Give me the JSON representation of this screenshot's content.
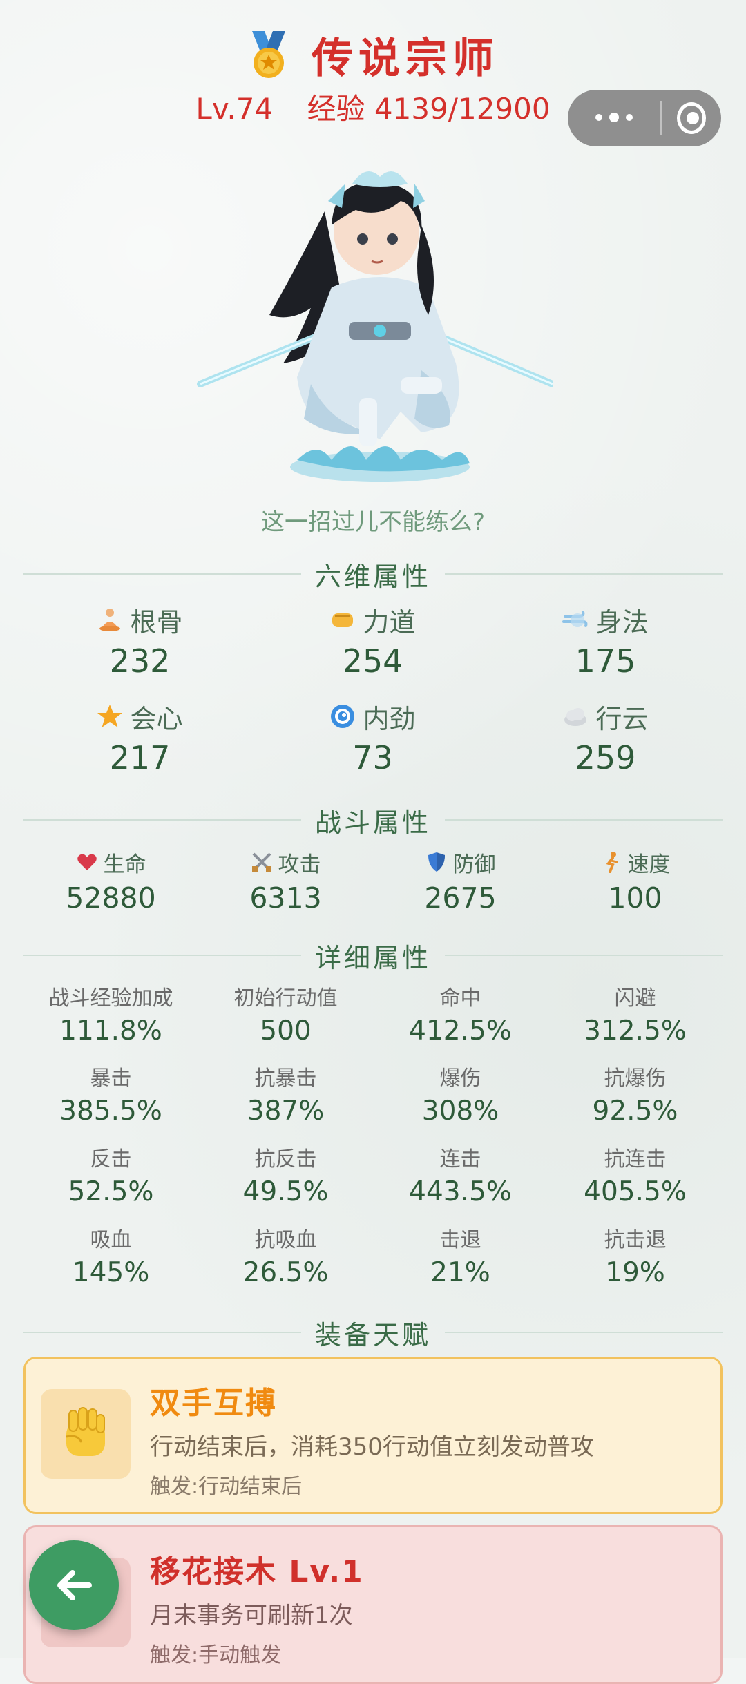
{
  "header": {
    "rank_title": "传说宗师",
    "level": "Lv.74",
    "exp_text": "经验 4139/12900"
  },
  "character": {
    "quote": "这一招过儿不能练么?"
  },
  "sections": {
    "six": "六维属性",
    "combat": "战斗属性",
    "detail": "详细属性",
    "talent": "装备天赋"
  },
  "six_attrs": [
    {
      "label": "根骨",
      "value": "232",
      "icon": "meditate-icon"
    },
    {
      "label": "力道",
      "value": "254",
      "icon": "fist-icon"
    },
    {
      "label": "身法",
      "value": "175",
      "icon": "wind-icon"
    },
    {
      "label": "会心",
      "value": "217",
      "icon": "star-icon"
    },
    {
      "label": "内劲",
      "value": "73",
      "icon": "swirl-icon"
    },
    {
      "label": "行云",
      "value": "259",
      "icon": "cloud-icon"
    }
  ],
  "combat_attrs": [
    {
      "label": "生命",
      "value": "52880",
      "icon": "heart-icon"
    },
    {
      "label": "攻击",
      "value": "6313",
      "icon": "crossed-swords-icon"
    },
    {
      "label": "防御",
      "value": "2675",
      "icon": "shield-icon"
    },
    {
      "label": "速度",
      "value": "100",
      "icon": "runner-icon"
    }
  ],
  "detail_attrs": [
    {
      "label": "战斗经验加成",
      "value": "111.8%"
    },
    {
      "label": "初始行动值",
      "value": "500"
    },
    {
      "label": "命中",
      "value": "412.5%"
    },
    {
      "label": "闪避",
      "value": "312.5%"
    },
    {
      "label": "暴击",
      "value": "385.5%"
    },
    {
      "label": "抗暴击",
      "value": "387%"
    },
    {
      "label": "爆伤",
      "value": "308%"
    },
    {
      "label": "抗爆伤",
      "value": "92.5%"
    },
    {
      "label": "反击",
      "value": "52.5%"
    },
    {
      "label": "抗反击",
      "value": "49.5%"
    },
    {
      "label": "连击",
      "value": "443.5%"
    },
    {
      "label": "抗连击",
      "value": "405.5%"
    },
    {
      "label": "吸血",
      "value": "145%"
    },
    {
      "label": "抗吸血",
      "value": "26.5%"
    },
    {
      "label": "击退",
      "value": "21%"
    },
    {
      "label": "抗击退",
      "value": "19%"
    }
  ],
  "talents": [
    {
      "title": "双手互搏",
      "desc": "行动结束后，消耗350行动值立刻发动普攻",
      "trigger": "触发:行动结束后",
      "icon": "raised-fist-icon"
    },
    {
      "title": "移花接木  Lv.1",
      "desc": "月末事务可刷新1次",
      "trigger": "触发:手动触发",
      "icon": "leaf-icon"
    }
  ],
  "colors": {
    "rank": "#d4302b",
    "value_green": "#2e5a39",
    "talent_gold": "#f08a10",
    "talent_red": "#d0302b",
    "back_button": "#3e9c63"
  }
}
